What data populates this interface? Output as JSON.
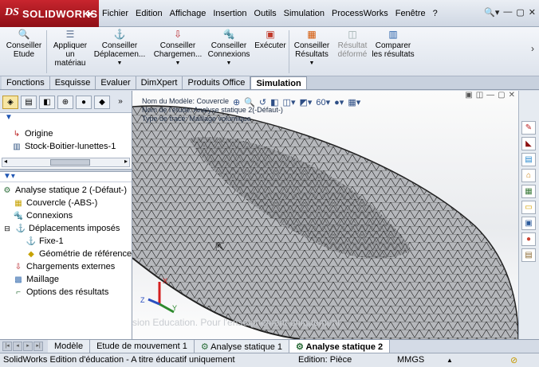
{
  "app": {
    "brand": "SOLIDWORKS",
    "menus": [
      "Fichier",
      "Edition",
      "Affichage",
      "Insertion",
      "Outils",
      "Simulation",
      "ProcessWorks",
      "Fenêtre",
      "?"
    ]
  },
  "ribbon": {
    "buttons": [
      {
        "label": "Conseiller Etude",
        "icon": "magnifier-icon"
      },
      {
        "label": "Appliquer un matériau",
        "icon": "material-icon"
      },
      {
        "label": "Conseiller Déplacemen...",
        "icon": "fixture-icon"
      },
      {
        "label": "Conseiller Chargemen...",
        "icon": "load-icon"
      },
      {
        "label": "Conseiller Connexions",
        "icon": "connection-icon"
      },
      {
        "label": "Exécuter",
        "icon": "run-icon"
      },
      {
        "label": "Conseiller Résultats",
        "icon": "results-icon"
      },
      {
        "label": "Résultat déformé",
        "icon": "deformed-icon"
      },
      {
        "label": "Comparer les résultats",
        "icon": "compare-icon"
      }
    ]
  },
  "tabs": [
    {
      "label": "Fonctions"
    },
    {
      "label": "Esquisse"
    },
    {
      "label": "Evaluer"
    },
    {
      "label": "DimXpert"
    },
    {
      "label": "Produits Office"
    },
    {
      "label": "Simulation",
      "active": true
    }
  ],
  "feature_tree": [
    {
      "label": "Origine",
      "icon": "origin-icon"
    },
    {
      "label": "Stock-Boitier-lunettes-1",
      "icon": "sheet-icon"
    }
  ],
  "study_tree": [
    {
      "label": "Analyse statique 2 (-Défaut-)",
      "icon": "study-icon",
      "level": 0
    },
    {
      "label": "Couvercle (-ABS-)",
      "icon": "part-icon",
      "level": 1
    },
    {
      "label": "Connexions",
      "icon": "connection-icon",
      "level": 1
    },
    {
      "label": "Déplacements imposés",
      "icon": "fixture-icon",
      "level": 1
    },
    {
      "label": "Fixe-1",
      "icon": "fixed-icon",
      "level": 2
    },
    {
      "label": "Géométrie de référence-1",
      "icon": "reference-geometry-icon",
      "level": 2
    },
    {
      "label": "Chargements externes",
      "icon": "load-icon",
      "level": 1
    },
    {
      "label": "Maillage",
      "icon": "mesh-icon",
      "level": 1
    },
    {
      "label": "Options des résultats",
      "icon": "results-options-icon",
      "level": 1
    }
  ],
  "viewport": {
    "info": [
      "Nom du Modèle: Couvercle",
      "Nom de l'étude: Analyse statique 2(-Défaut-)",
      "Type de tracé: Maillage volumique"
    ],
    "watermark": "sion Education. Pour l'enseignement uniquement"
  },
  "doc_tabs": [
    {
      "label": "Modèle"
    },
    {
      "label": "Etude de mouvement 1"
    },
    {
      "label": "Analyse statique 1"
    },
    {
      "label": "Analyse statique 2",
      "active": true
    }
  ],
  "status": {
    "left": "SolidWorks Edition d'éducation - A titre éducatif uniquement",
    "edition": "Edition: Pièce",
    "units": "MMGS"
  }
}
